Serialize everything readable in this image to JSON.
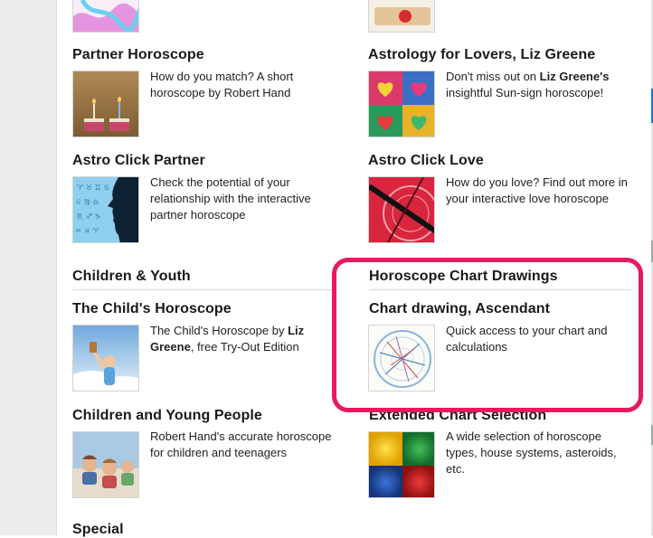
{
  "items": {
    "partner_horoscope": {
      "title": "Partner Horoscope",
      "desc": "How do you match? A short horoscope by Robert Hand",
      "icon": "birthday-candles-image"
    },
    "astrology_lovers": {
      "title": "Astrology for Lovers, Liz Greene",
      "desc_pre": "Don't miss out on ",
      "desc_bold": "Liz Greene's",
      "desc_post": " insightful Sun-sign horoscope!",
      "icon": "hearts-image"
    },
    "astro_click_partner": {
      "title": "Astro Click Partner",
      "desc": "Check the potential of your relationship with the interactive partner horoscope",
      "icon": "face-silhouette-image"
    },
    "astro_click_love": {
      "title": "Astro Click Love",
      "desc": "How do you love? Find out more in your interactive love horoscope",
      "icon": "love-chart-image"
    },
    "childs_horoscope": {
      "title": "The Child's Horoscope",
      "desc_pre": "The Child's Horoscope by ",
      "desc_bold": "Liz Greene",
      "desc_post": ", free Try-Out Edition",
      "icon": "child-sky-image"
    },
    "chart_drawing": {
      "title": "Chart drawing, Ascendant",
      "desc": "Quick access to your chart and calculations",
      "icon": "horoscope-wheel-image"
    },
    "children_young": {
      "title": "Children and Young People",
      "desc": "Robert Hand's accurate horoscope for children and teenagers",
      "icon": "children-beach-image"
    },
    "extended_chart": {
      "title": "Extended Chart Selection",
      "desc": "A wide selection of horoscope types, house systems, asteroids, etc.",
      "icon": "color-squares-image"
    }
  },
  "sections": {
    "children_youth": "Children & Youth",
    "chart_drawings": "Horoscope Chart Drawings",
    "special": "Special"
  },
  "colors": {
    "highlight": "#e8195f",
    "accent_blue": "#1b76c8"
  }
}
